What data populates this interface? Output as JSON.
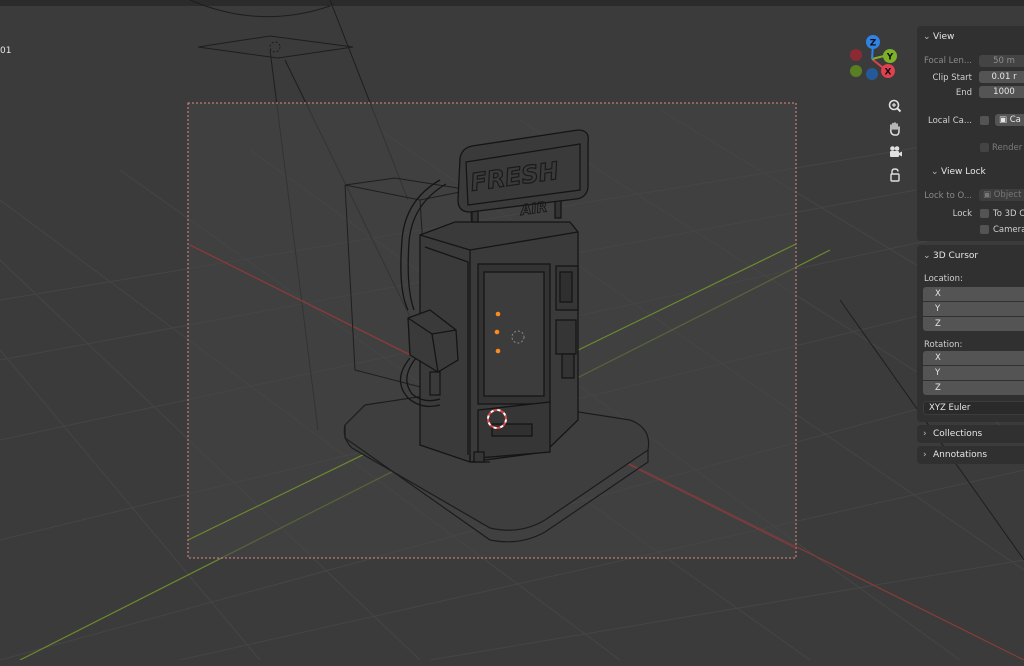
{
  "viewport": {
    "corner_label": "01",
    "sign_text_top": "FRESH",
    "sign_text_bottom": "AIR"
  },
  "gizmo": {
    "x_label": "X",
    "y_label": "Y",
    "z_label": "Z",
    "colors": {
      "x": "#e0404f",
      "y": "#7db228",
      "z": "#2f83e6"
    }
  },
  "nav_icons": [
    "zoom-icon",
    "hand-pan-icon",
    "camera-icon",
    "lock-icon"
  ],
  "panel": {
    "view": {
      "title": "View",
      "focal_length_label": "Focal Len...",
      "focal_length_value": "50 m",
      "clip_start_label": "Clip Start",
      "clip_start_value": "0.01 r",
      "clip_end_label": "End",
      "clip_end_value": "1000",
      "local_camera_label": "Local Ca...",
      "local_camera_value": "Ca",
      "render_region_label": "Render R"
    },
    "view_lock": {
      "title": "View Lock",
      "lock_to_object_label": "Lock to O...",
      "lock_to_object_placeholder": "Object",
      "lock_label": "Lock",
      "to_3d_cursor_label": "To 3D C",
      "camera_label": "Camera"
    },
    "cursor": {
      "title": "3D Cursor",
      "location_label": "Location:",
      "location_axes": [
        "X",
        "Y",
        "Z"
      ],
      "rotation_label": "Rotation:",
      "rotation_axes": [
        "X",
        "Y",
        "Z"
      ],
      "rotation_mode": "XYZ Euler"
    },
    "collections": {
      "title": "Collections"
    },
    "annotations": {
      "title": "Annotations"
    }
  }
}
